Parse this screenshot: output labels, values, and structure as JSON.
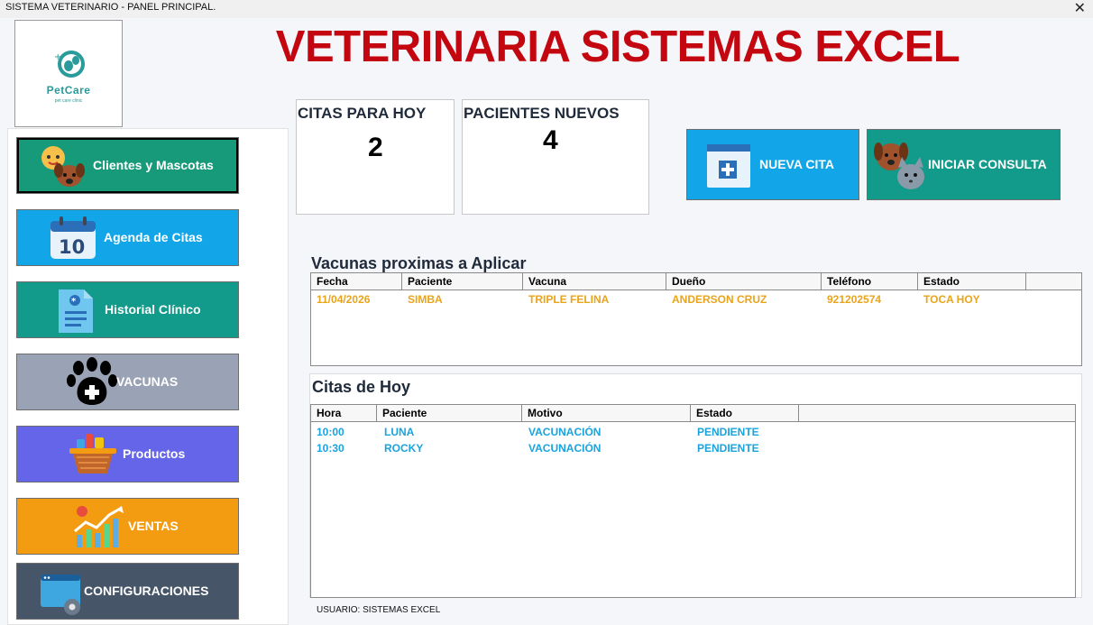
{
  "window": {
    "title": "SISTEMA VETERINARIO - PANEL PRINCIPAL.",
    "close_glyph": "✕"
  },
  "logo": {
    "text": "PetCare",
    "subtext": "pet care clinic"
  },
  "header": {
    "title": "VETERINARIA SISTEMAS EXCEL",
    "title_color": "#c3060f"
  },
  "sidebar": {
    "items": [
      {
        "label": "Clientes y Mascotas",
        "color": "#179a7a",
        "icon": "pets-family-icon"
      },
      {
        "label": "Agenda de Citas",
        "color": "#12a6e9",
        "icon": "calendar-icon",
        "calendar_day": "10"
      },
      {
        "label": "Historial Clínico",
        "color": "#129a8a",
        "icon": "medical-record-icon"
      },
      {
        "label": "VACUNAS",
        "color": "#9aa3b5",
        "icon": "paw-plus-icon"
      },
      {
        "label": "Productos",
        "color": "#6565ea",
        "icon": "pet-basket-icon"
      },
      {
        "label": "VENTAS",
        "color": "#f39c12",
        "icon": "sales-chart-icon"
      },
      {
        "label": "CONFIGURACIONES",
        "color": "#475569",
        "icon": "settings-window-icon"
      }
    ]
  },
  "stats": {
    "citas_hoy": {
      "label": "CITAS PARA HOY",
      "value": "2"
    },
    "pacientes_nuevos": {
      "label": "PACIENTES NUEVOS",
      "value": "4"
    }
  },
  "actions": {
    "nueva_cita": {
      "label": "NUEVA CITA",
      "color": "#12a6e9"
    },
    "iniciar_consulta": {
      "label": "INICIAR CONSULTA",
      "color": "#129a8a"
    }
  },
  "vacunas": {
    "title": "Vacunas proximas a Aplicar",
    "row_color": "#e8a41c",
    "columns": [
      "Fecha",
      "Paciente",
      "Vacuna",
      "Dueño",
      "Teléfono",
      "Estado"
    ],
    "rows": [
      [
        "11/04/2026",
        "SIMBA",
        "TRIPLE FELINA",
        "ANDERSON CRUZ",
        "921202574",
        "TOCA HOY"
      ]
    ]
  },
  "citas": {
    "title": "Citas de Hoy",
    "row_color": "#1aa3dd",
    "columns": [
      "Hora",
      "Paciente",
      "Motivo",
      "Estado"
    ],
    "rows": [
      [
        "10:00",
        "LUNA",
        "VACUNACIÓN",
        "PENDIENTE"
      ],
      [
        "10:30",
        "ROCKY",
        "VACUNACIÓN",
        "PENDIENTE"
      ]
    ]
  },
  "footer": {
    "usuario": "USUARIO: SISTEMAS EXCEL"
  }
}
